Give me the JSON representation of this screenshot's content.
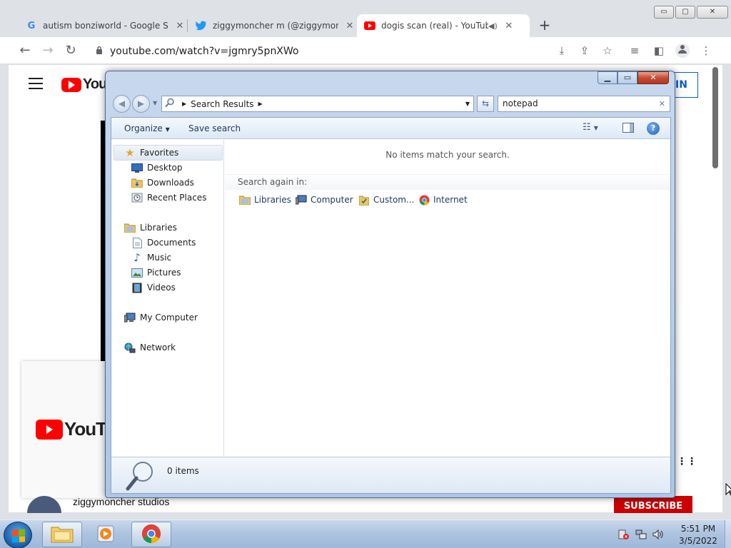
{
  "browser": {
    "tabs": [
      {
        "title": "autism bonziworld - Google Search",
        "favicon": "google-icon"
      },
      {
        "title": "ziggymoncher m (@ziggymoncher)",
        "favicon": "twitter-icon"
      },
      {
        "title": "dogis scan (real) - YouTube",
        "favicon": "youtube-icon",
        "active": true,
        "audio": true
      }
    ],
    "new_tab": "+",
    "url": "youtube.com/watch?v=jgmry5pnXWo",
    "window_controls": {
      "minimize": "▭",
      "maximize": "▢",
      "close": "✕"
    }
  },
  "youtube": {
    "logo_text": "YouTube",
    "sign_in": "IN",
    "channel_name": "ziggymoncher studios",
    "subscribe": "SUBSCRIBE",
    "more": "⋮⋮"
  },
  "explorer": {
    "address": {
      "location": "Search Results"
    },
    "search": {
      "value": "notepad",
      "clear": "✕"
    },
    "commands": {
      "organize": "Organize",
      "save_search": "Save search"
    },
    "nav": {
      "favorites": "Favorites",
      "desktop": "Desktop",
      "downloads": "Downloads",
      "recent_places": "Recent Places",
      "libraries": "Libraries",
      "documents": "Documents",
      "music": "Music",
      "pictures": "Pictures",
      "videos": "Videos",
      "my_computer": "My Computer",
      "network": "Network"
    },
    "content": {
      "no_items": "No items match your search.",
      "search_again": "Search again in:",
      "locations": [
        "Libraries",
        "Computer",
        "Custom...",
        "Internet"
      ]
    },
    "details": {
      "count": "0 items"
    },
    "help": "?"
  },
  "taskbar": {
    "clock_time": "5:51 PM",
    "clock_date": "3/5/2022"
  },
  "colors": {
    "youtube_red": "#ff0000",
    "explorer_frame": "#b6cde8",
    "taskbar": "#aec4e0"
  }
}
